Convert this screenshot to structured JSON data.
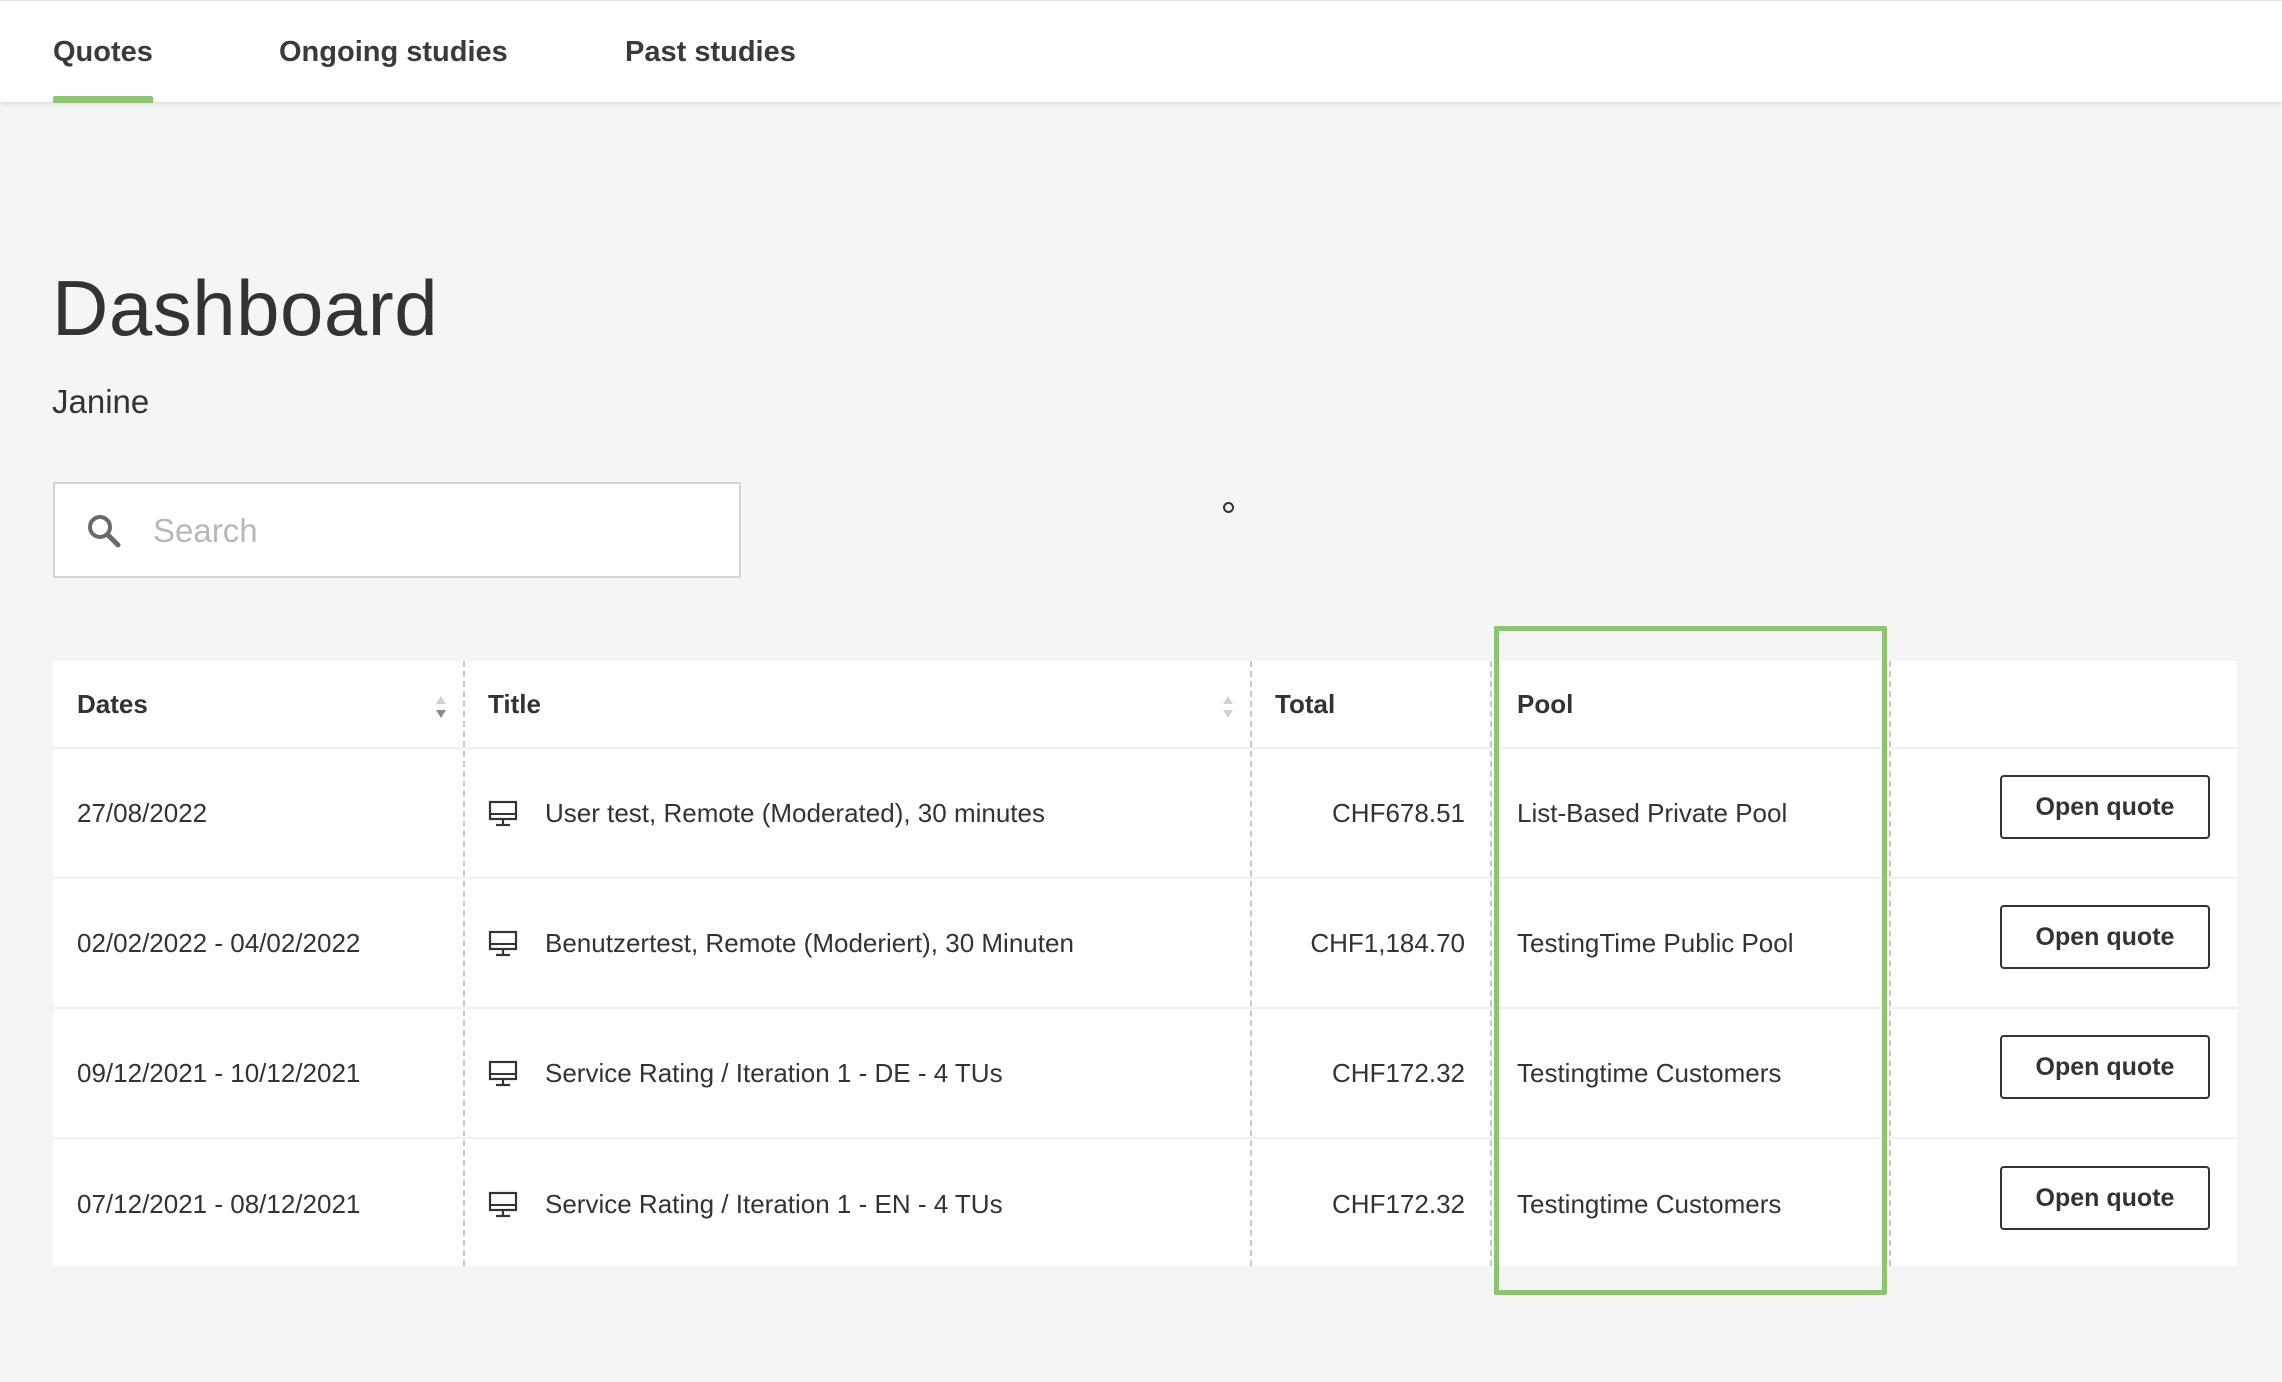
{
  "nav": {
    "tabs": [
      {
        "label": "Quotes",
        "active": true
      },
      {
        "label": "Ongoing studies",
        "active": false
      },
      {
        "label": "Past studies",
        "active": false
      }
    ]
  },
  "page": {
    "title": "Dashboard",
    "user_name": "Janine"
  },
  "search": {
    "placeholder": "Search",
    "value": ""
  },
  "table": {
    "columns": [
      "Dates",
      "Title",
      "Total",
      "Pool",
      ""
    ],
    "rows": [
      {
        "dates": "27/08/2022",
        "title": "User test, Remote (Moderated), 30 minutes",
        "total": "CHF678.51",
        "pool": "List-Based Private Pool",
        "action": "Open quote"
      },
      {
        "dates": "02/02/2022 - 04/02/2022",
        "title": "Benutzertest, Remote (Moderiert), 30 Minuten",
        "total": "CHF1,184.70",
        "pool": "TestingTime Public Pool",
        "action": "Open quote"
      },
      {
        "dates": "09/12/2021 - 10/12/2021",
        "title": "Service Rating / Iteration 1 - DE - 4 TUs",
        "total": "CHF172.32",
        "pool": "Testingtime Customers",
        "action": "Open quote"
      },
      {
        "dates": "07/12/2021 - 08/12/2021",
        "title": "Service Rating / Iteration 1 - EN - 4 TUs",
        "total": "CHF172.32",
        "pool": "Testingtime Customers",
        "action": "Open quote"
      }
    ]
  },
  "icons": {
    "search": "search-icon",
    "sort": "sort-arrows-icon",
    "row_type": "monitor-icon"
  },
  "colors": {
    "accent": "#8cc46f",
    "background": "#f5f5f5",
    "text": "#333333"
  }
}
